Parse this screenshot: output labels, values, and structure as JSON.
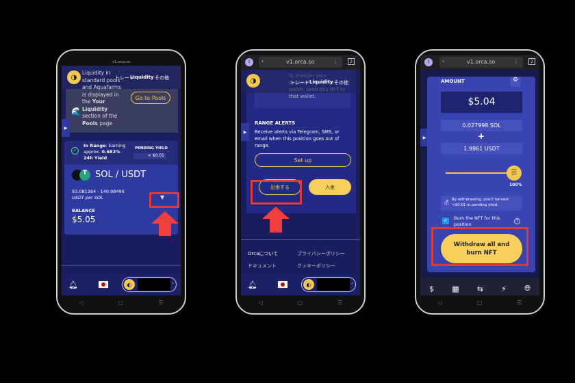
{
  "phone1": {
    "url": "v1.orca.so",
    "nav": {
      "trade": "トレード",
      "liquidity": "Liquidity",
      "other": "その他"
    },
    "banner": {
      "text_plain1": "Liquidity in standard pools and Aquafarms is displayed in the ",
      "text_bold1": "Your Liquidity",
      "text_plain2": " section of the ",
      "text_bold2": "Pools",
      "text_plain3": " page",
      "button": "Go to Pools"
    },
    "status": {
      "label": "In Range",
      "text": ": Earning approx. ",
      "pct": "0.682%",
      "yield": "24h Yield"
    },
    "pending": {
      "label": "PENDING YIELD",
      "value": "< $0.01"
    },
    "pair": "SOL / USDT",
    "range": "93.081364 - 140.98496",
    "range_unit": "USDT per SOL",
    "balance_label": "BALANCE",
    "balance": "$5.05"
  },
  "phone2": {
    "tab_count": "1",
    "url": "v1.orca.so",
    "tabs": "2",
    "nav": {
      "trade": "トレード",
      "liquidity": "Liquidity",
      "other": "その他"
    },
    "nft_text": "To transfer your position to another wallet, send this NFT to that wallet.",
    "alerts_title": "RANGE ALERTS",
    "alerts_text": "Receive alerts via Telegram, SMS, or email when this position goes out of range.",
    "setup": "Set up",
    "withdraw": "出金する",
    "deposit": "入金",
    "footer": [
      "Orcaについて",
      "プライバシーポリシー",
      "ドキュメント",
      "クッキーポリシー"
    ]
  },
  "phone3": {
    "tab_count": "1",
    "url": "v1.orca.so",
    "tabs": "2",
    "amount_label": "AMOUNT",
    "amount": "$5.04",
    "sol": "0.027998 SOL",
    "plus": "+",
    "usdt": "1.9861 USDT",
    "slider_pct": 100,
    "slider_label": "100%",
    "harvest_note": "By withdrawing, you'll harvest <$0.01 in pending yield.",
    "burn_label": "Burn the NFT for this position",
    "burn_checked": true,
    "withdraw_btn": "Withdraw all and burn NFT"
  },
  "colors": {
    "accent": "#f6c94d",
    "highlight": "#e53935",
    "card": "#2f3aa0",
    "bg": "#1a1e5e"
  }
}
